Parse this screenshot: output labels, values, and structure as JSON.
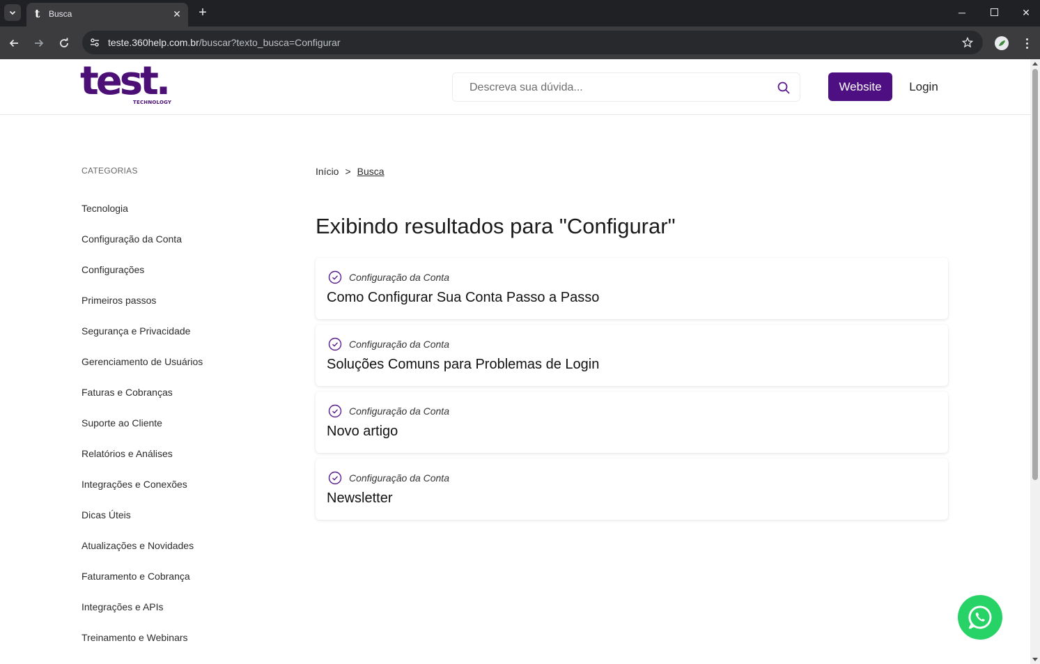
{
  "browser": {
    "tab_title": "Busca",
    "tab_favicon_letter": "t",
    "url_host": "teste.360help.com.br",
    "url_path": "/buscar?texto_busca=Configurar"
  },
  "header": {
    "logo_text": "test.",
    "logo_subtext": "TECHNOLOGY",
    "search_placeholder": "Descreva sua dúvida...",
    "website_label": "Website",
    "login_label": "Login"
  },
  "sidebar": {
    "title": "CATEGORIAS",
    "items": [
      "Tecnologia",
      "Configuração da Conta",
      "Configurações",
      "Primeiros passos",
      "Segurança e Privacidade",
      "Gerenciamento de Usuários",
      "Faturas e Cobranças",
      "Suporte ao Cliente",
      "Relatórios e Análises",
      "Integrações e Conexões",
      "Dicas Úteis",
      "Atualizações e Novidades",
      "Faturamento e Cobrança",
      "Integrações e APIs",
      "Treinamento e Webinars"
    ]
  },
  "breadcrumb": {
    "home": "Início",
    "separator": ">",
    "current": "Busca"
  },
  "main": {
    "heading": "Exibindo resultados para \"Configurar\"",
    "results": [
      {
        "category": "Configuração da Conta",
        "title": "Como Configurar Sua Conta Passo a Passo"
      },
      {
        "category": "Configuração da Conta",
        "title": "Soluções Comuns para Problemas de Login"
      },
      {
        "category": "Configuração da Conta",
        "title": "Novo artigo"
      },
      {
        "category": "Configuração da Conta",
        "title": "Newsletter"
      }
    ]
  },
  "colors": {
    "brand": "#4e0f82",
    "whatsapp": "#27d366"
  },
  "icons": [
    "search-icon",
    "check-circle-icon",
    "whatsapp-icon",
    "star-icon",
    "back-arrow-icon",
    "forward-arrow-icon",
    "reload-icon"
  ]
}
